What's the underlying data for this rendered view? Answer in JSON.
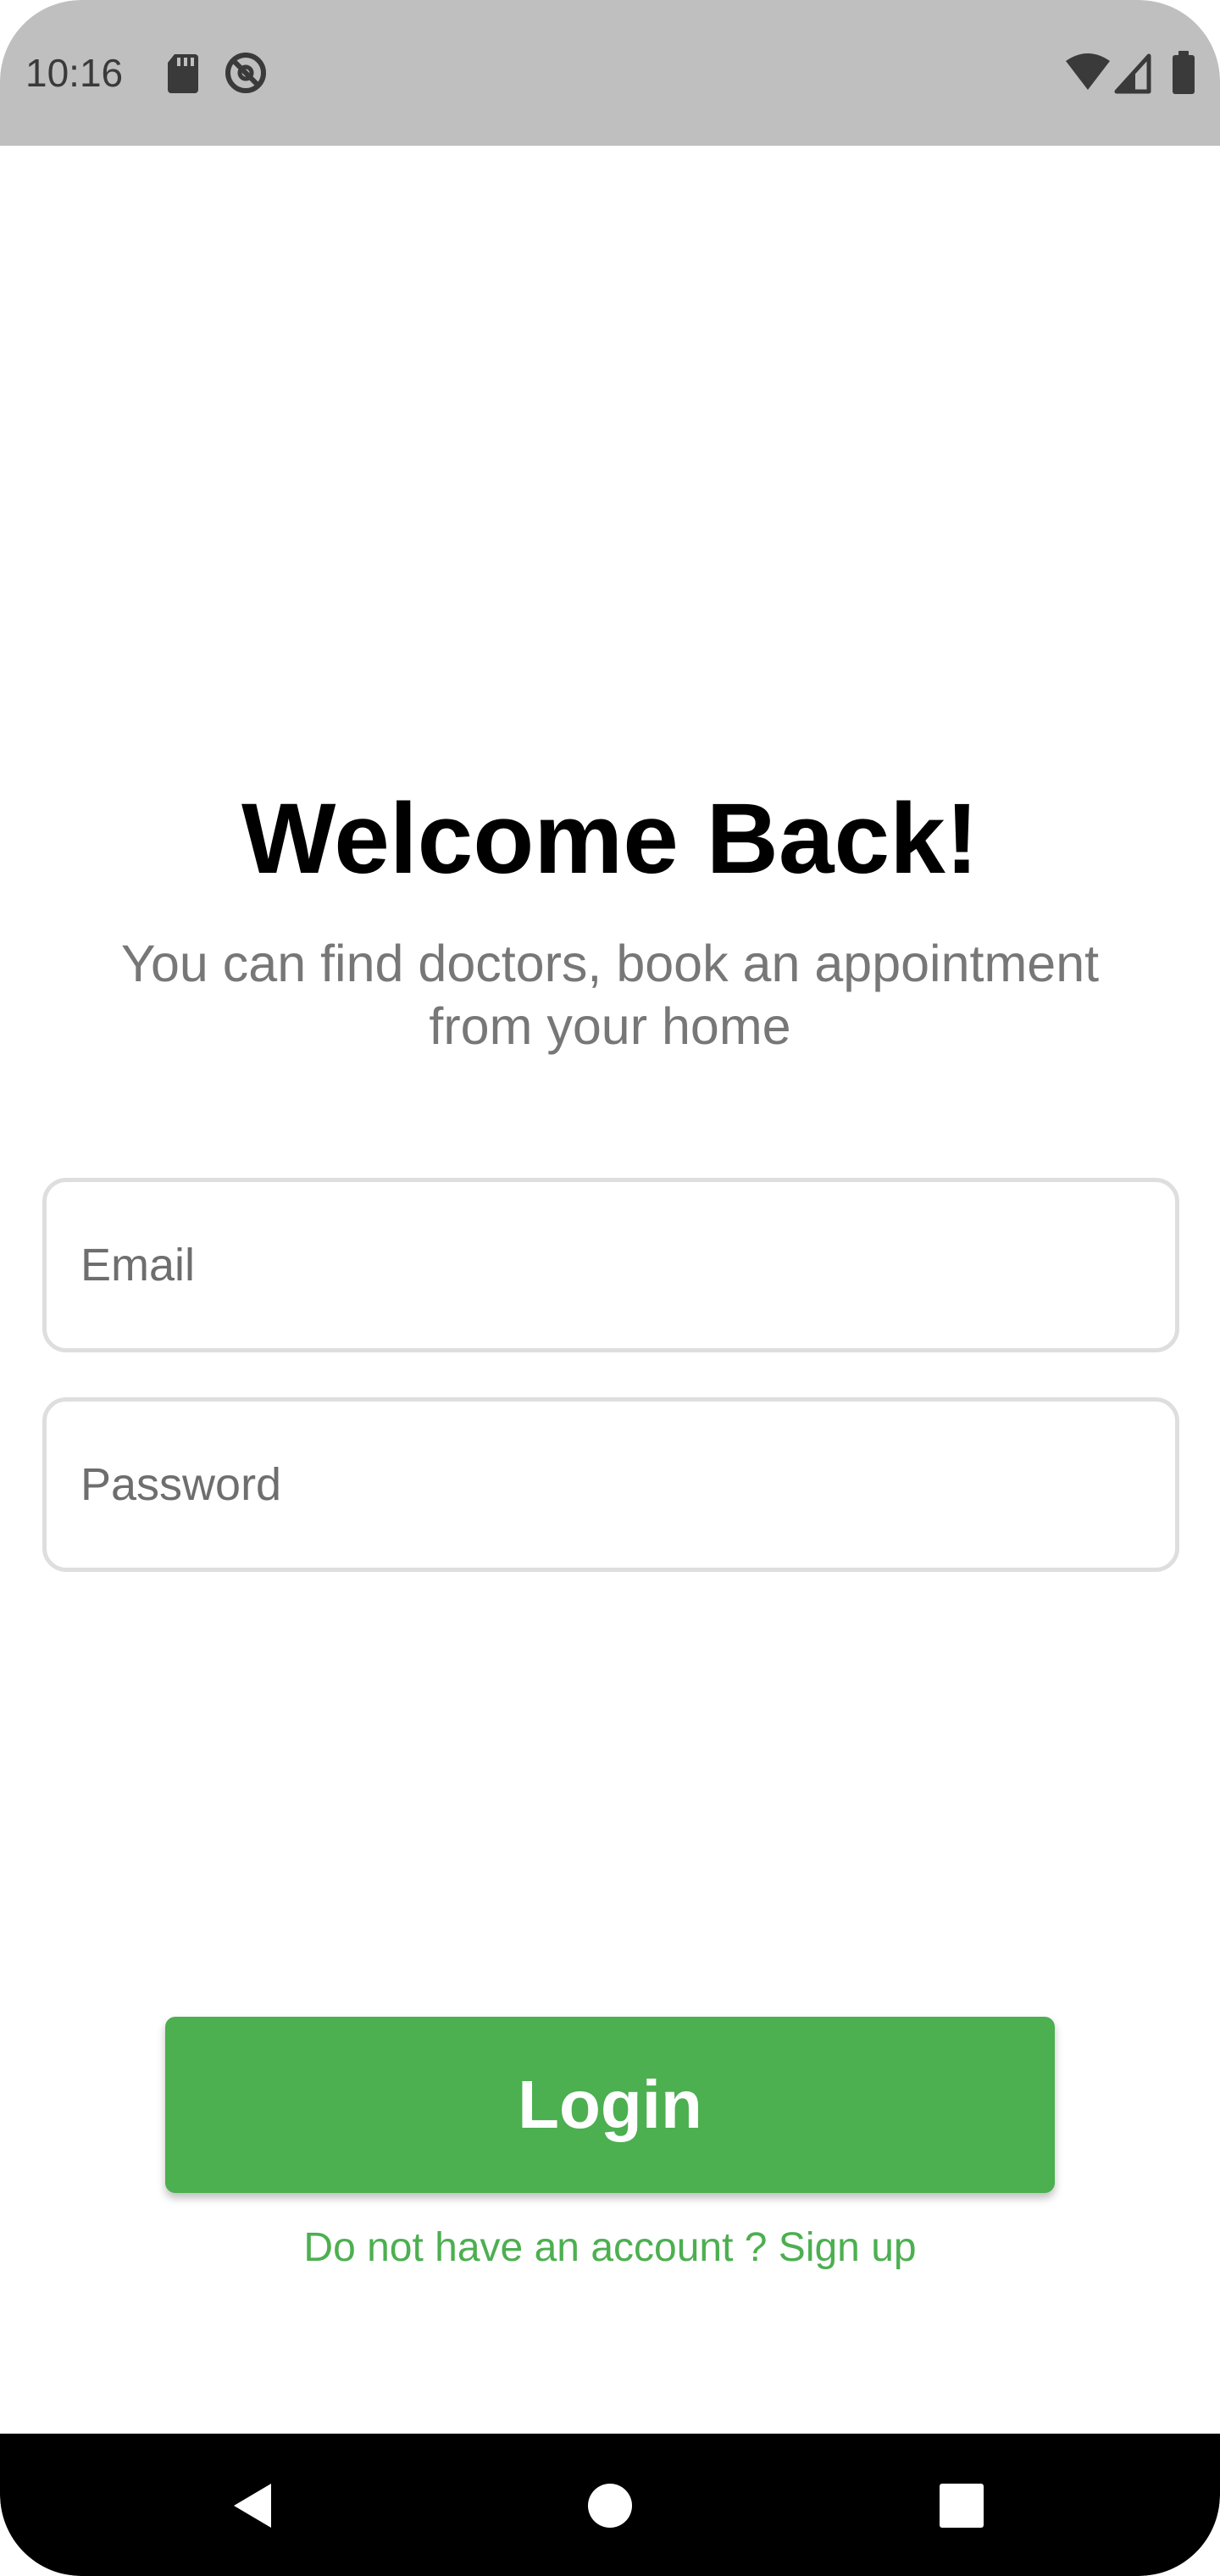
{
  "status_bar": {
    "time": "10:16",
    "left_icons": [
      "sd-card-icon",
      "do-not-disturb-icon"
    ],
    "right_icons": [
      "wifi-icon",
      "cellular-signal-icon",
      "battery-icon"
    ],
    "background": "#bfbfbf"
  },
  "login": {
    "title": "Welcome Back!",
    "subtitle": "You can find doctors, book an appointment from your home",
    "email": {
      "placeholder": "Email",
      "value": ""
    },
    "password": {
      "placeholder": "Password",
      "value": ""
    },
    "login_button_label": "Login",
    "signup_link": "Do not have an account ? Sign up"
  },
  "nav_bar": {
    "buttons": [
      "back-icon",
      "home-icon",
      "recents-icon"
    ]
  },
  "colors": {
    "accent": "#4caf50",
    "subtitle": "#777777",
    "field_border": "#dedede"
  }
}
